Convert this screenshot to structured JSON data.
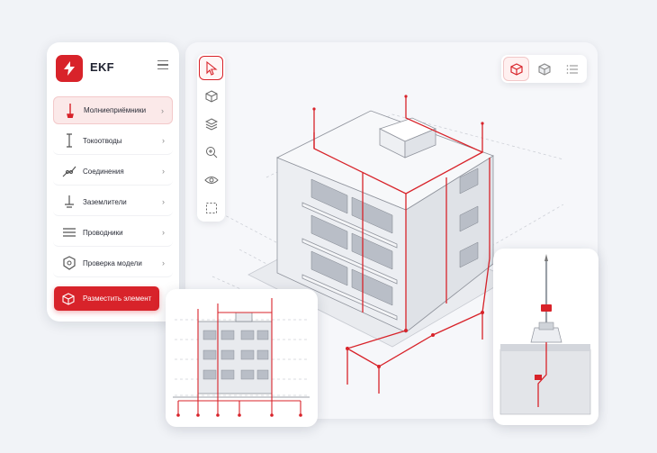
{
  "brand": {
    "name": "EKF",
    "accent": "#d8232a"
  },
  "sidebar": {
    "items": [
      {
        "label": "Молниеприёмники",
        "icon": "lightning-rod-icon",
        "active": true
      },
      {
        "label": "Токоотводы",
        "icon": "down-conductor-icon",
        "active": false
      },
      {
        "label": "Соединения",
        "icon": "connection-icon",
        "active": false
      },
      {
        "label": "Заземлители",
        "icon": "ground-electrode-icon",
        "active": false
      },
      {
        "label": "Проводники",
        "icon": "conductors-icon",
        "active": false
      },
      {
        "label": "Проверка модели",
        "icon": "model-check-icon",
        "active": false
      }
    ],
    "place_button": "Разместить элемент"
  },
  "toolbar": {
    "tools": [
      "cursor-icon",
      "box-view-icon",
      "layers-icon",
      "zoom-in-icon",
      "eye-icon",
      "selection-frame-icon"
    ],
    "active_tool": "cursor-icon"
  },
  "view_switcher": {
    "buttons": [
      "cube-red-icon",
      "cube-grey-icon",
      "list-icon"
    ],
    "active": "cube-red-icon"
  }
}
